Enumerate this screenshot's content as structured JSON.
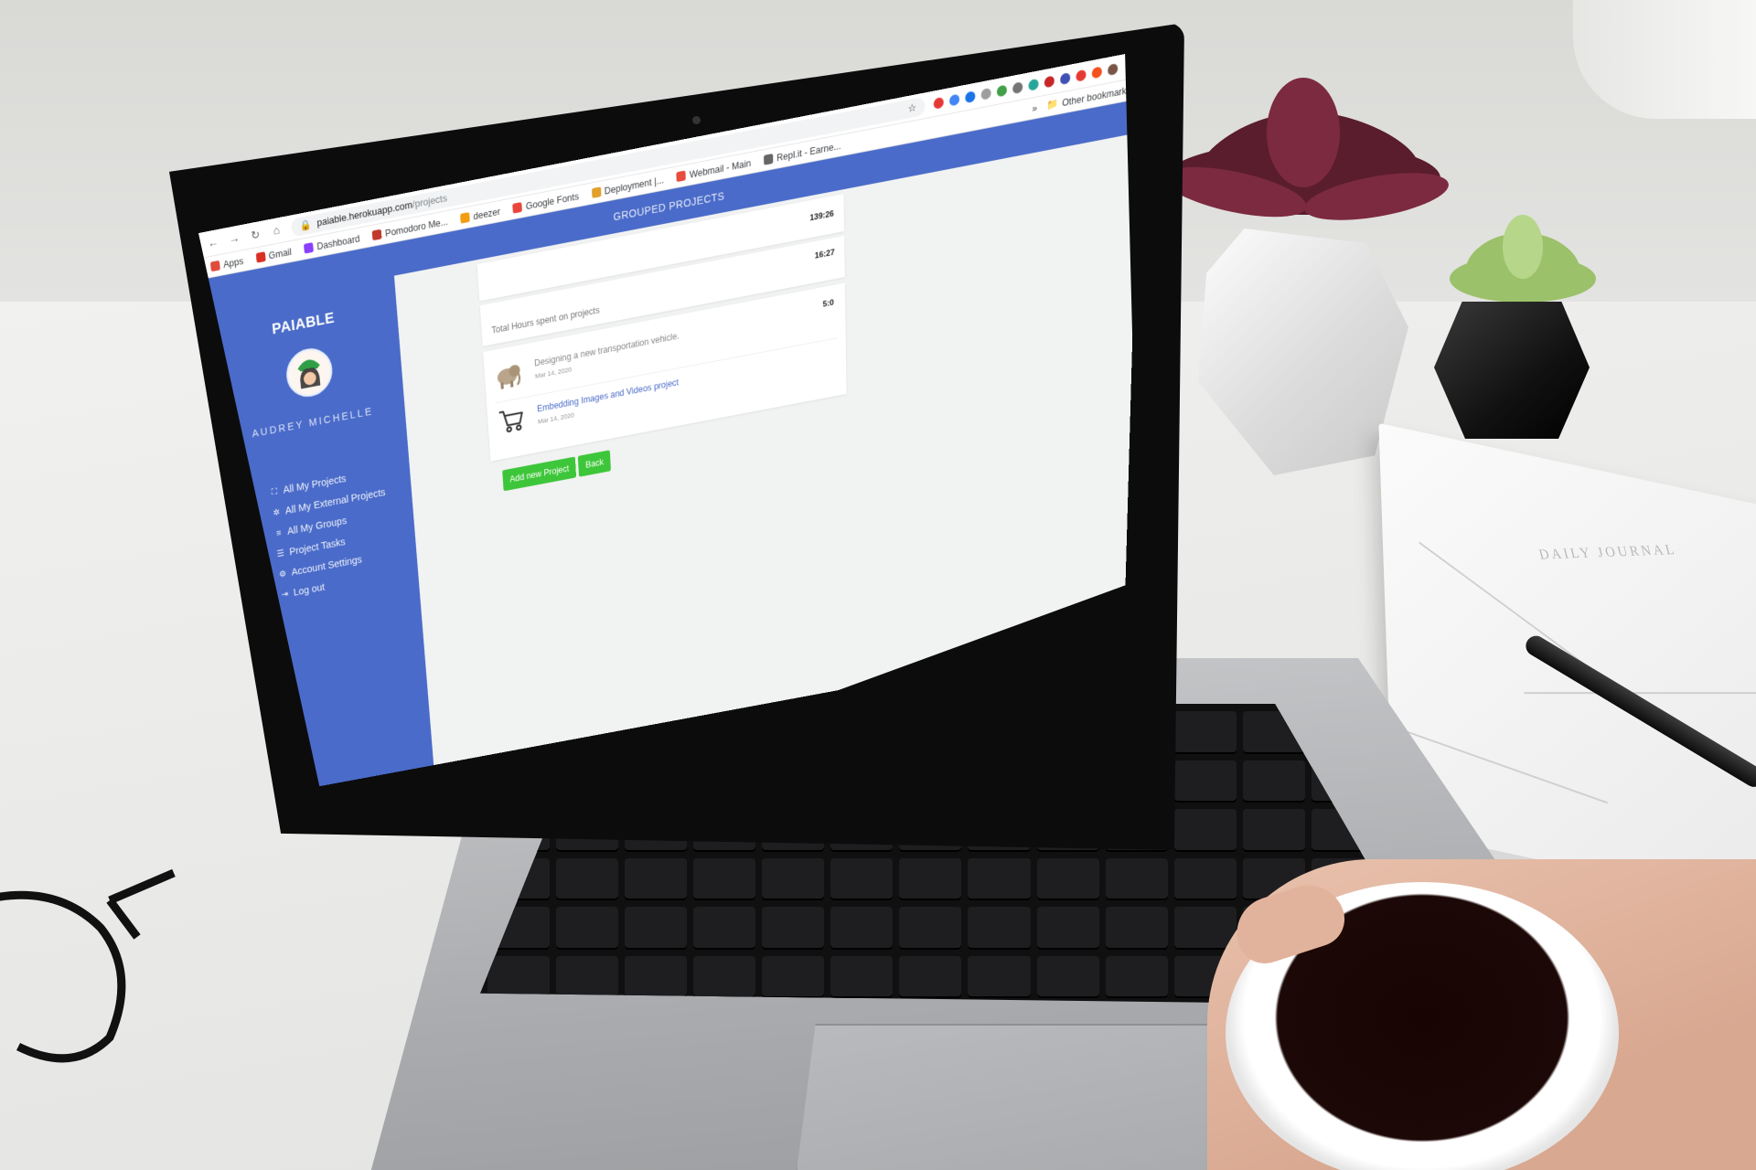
{
  "browser": {
    "url_host": "paiable.herokuapp.com",
    "url_path": "/projects",
    "bookmarks": [
      {
        "label": "Apps",
        "color": "#e04b3c"
      },
      {
        "label": "Gmail",
        "color": "#d93025"
      },
      {
        "label": "Dashboard",
        "color": "#8a3ffc"
      },
      {
        "label": "Pomodoro Me...",
        "color": "#c0392b"
      },
      {
        "label": "deezer",
        "color": "#f39c12"
      },
      {
        "label": "Google Fonts",
        "color": "#e8453c"
      },
      {
        "label": "Deployment |...",
        "color": "#e2a02a"
      },
      {
        "label": "Webmail - Main",
        "color": "#e74c3c"
      },
      {
        "label": "Repl.it - Earne...",
        "color": "#666666"
      }
    ],
    "overflow_label": "»",
    "other_bookmarks": "Other bookmarks"
  },
  "app": {
    "brand": "PAIABLE",
    "header_title": "GROUPED PROJECTS",
    "user_name": "AUDREY MICHELLE",
    "menu": [
      {
        "label": "All My Projects",
        "icon": "project-diagram-icon"
      },
      {
        "label": "All My External Projects",
        "icon": "external-projects-icon"
      },
      {
        "label": "All My Groups",
        "icon": "layers-icon"
      },
      {
        "label": "Project Tasks",
        "icon": "tasks-list-icon"
      },
      {
        "label": "Account Settings",
        "icon": "gears-icon"
      },
      {
        "label": "Log out",
        "icon": "sign-out-icon"
      }
    ],
    "totals": [
      {
        "label": "",
        "hours": "139:26"
      },
      {
        "label": "Total Hours spent on projects",
        "hours": "16:27"
      }
    ],
    "projects": [
      {
        "title": "Designing a new transportation vehicle.",
        "date": "Mar 14, 2020",
        "hours": "5:0",
        "thumb": "elephant-image"
      },
      {
        "title": "Embedding Images and Videos project",
        "date": "Mar 14, 2020",
        "hours": "",
        "thumb": "shopping-cart-icon"
      }
    ],
    "buttons": {
      "add": "Add new Project",
      "back": "Back"
    },
    "colors": {
      "primary": "#4a6bc9",
      "success": "#3ec63a"
    }
  },
  "scene": {
    "journal_title": "DAILY JOURNAL"
  }
}
